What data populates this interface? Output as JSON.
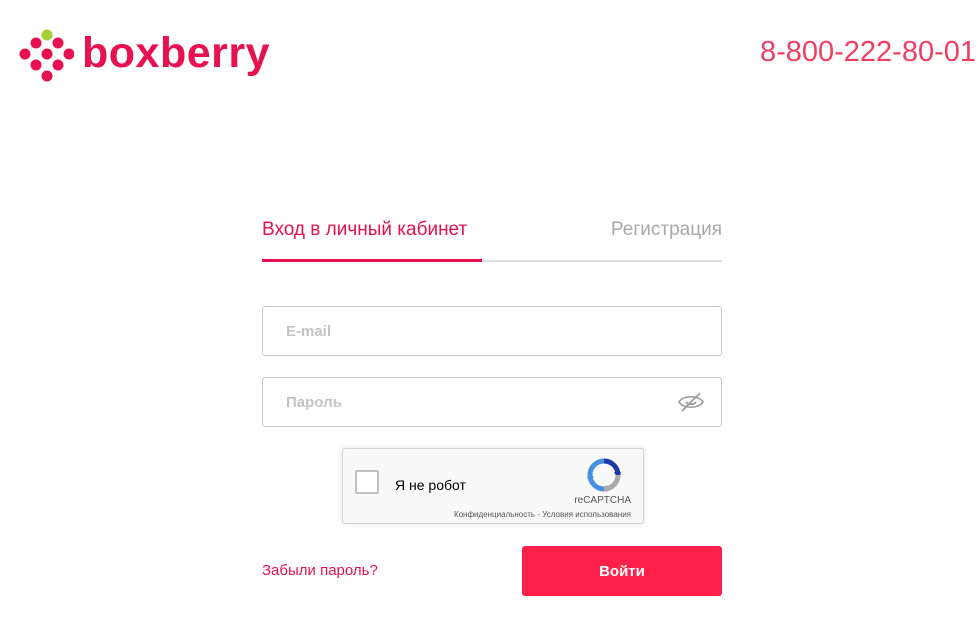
{
  "header": {
    "logo_text": "boxberry",
    "phone": "8-800-222-80-01"
  },
  "tabs": {
    "login_label": "Вход в личный кабинет",
    "register_label": "Регистрация",
    "active": "login"
  },
  "form": {
    "email_placeholder": "E-mail",
    "email_value": "",
    "password_placeholder": "Пароль",
    "password_value": "",
    "password_toggle_icon": "eye-hidden-icon"
  },
  "recaptcha": {
    "label": "Я не робот",
    "brand": "reCAPTCHA",
    "privacy_link": "Конфиденциальность",
    "separator": " - ",
    "terms_link": "Условия использования",
    "checked": false
  },
  "actions": {
    "forgot_label": "Забыли пароль?",
    "submit_label": "Войти"
  },
  "colors": {
    "brand": "#e8114f",
    "button": "#ff1f4b",
    "logo_accent": "#a8cf38"
  }
}
